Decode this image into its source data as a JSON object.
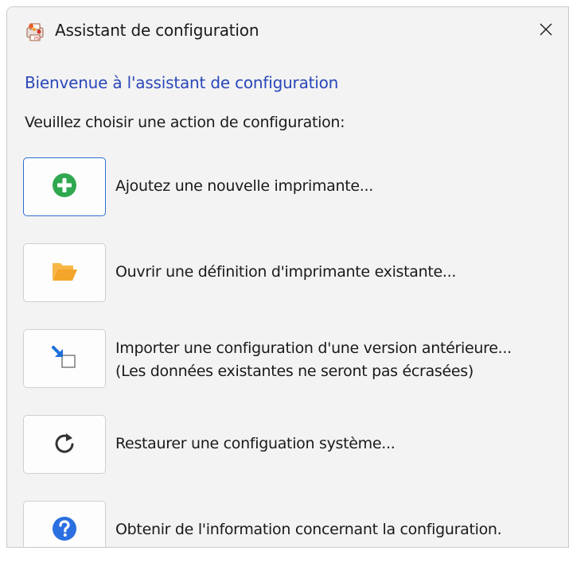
{
  "window": {
    "title": "Assistant de configuration",
    "app_icon": "printer-app-icon",
    "close_icon": "close-icon"
  },
  "header": {
    "welcome": "Bienvenue à l'assistant de configuration",
    "prompt": "Veuillez choisir une action de configuration:"
  },
  "actions": [
    {
      "icon": "plus-circle-icon",
      "label": "Ajoutez une nouvelle imprimante..."
    },
    {
      "icon": "folder-open-icon",
      "label": "Ouvrir une définition d'imprimante existante..."
    },
    {
      "icon": "import-arrow-icon",
      "label": "Importer une configuration d'une version antérieure...",
      "label2": "(Les données existantes ne seront pas écrasées)"
    },
    {
      "icon": "refresh-icon",
      "label": "Restaurer une configuation système..."
    },
    {
      "icon": "help-circle-icon",
      "label": "Obtenir de l'information concernant la configuration."
    }
  ],
  "colors": {
    "accent": "#2c6fd1",
    "welcome_text": "#2a47b8",
    "add_green": "#2fa84f",
    "folder_orange": "#f3a52b",
    "import_blue": "#1e6fd9",
    "help_blue": "#2b6fe0"
  }
}
